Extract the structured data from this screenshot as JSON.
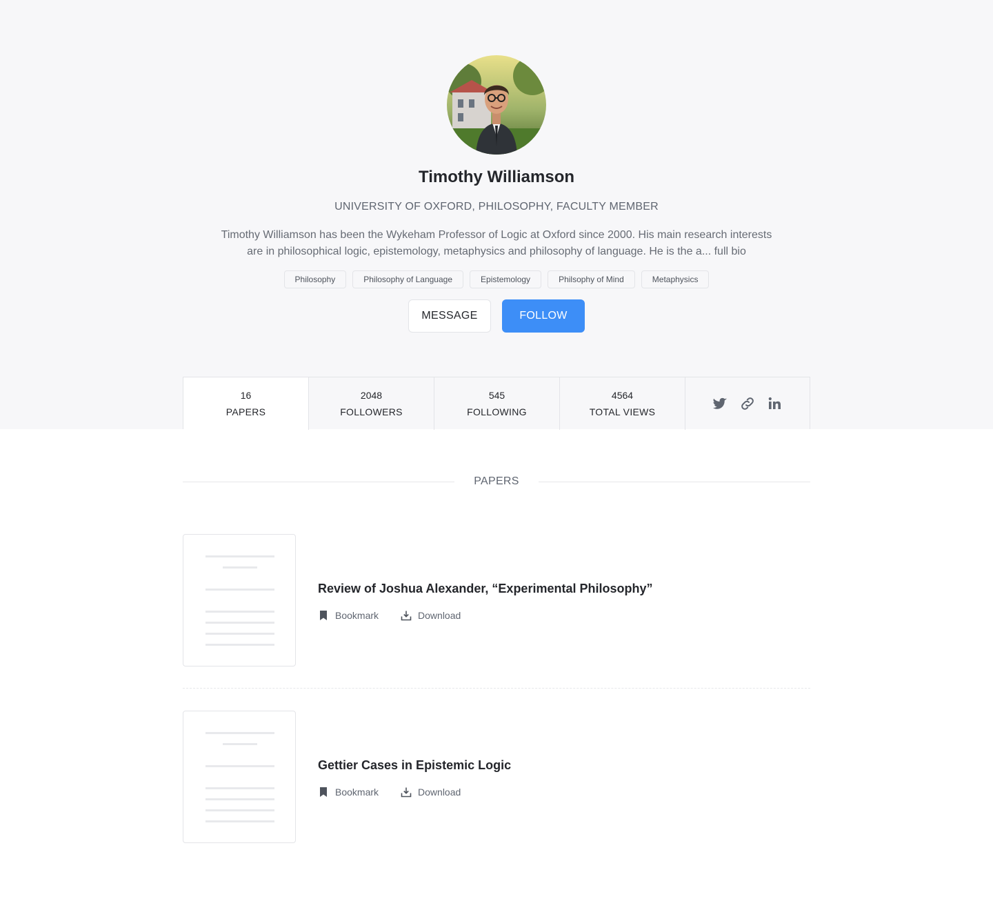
{
  "profile": {
    "name": "Timothy Williamson",
    "affiliation": "UNIVERSITY OF OXFORD, PHILOSOPHY, FACULTY MEMBER",
    "bio_line1": "Timothy Williamson has been the Wykeham Professor of Logic at Oxford since 2000. His main research interests",
    "bio_line2": "are in philosophical logic, epistemology, metaphysics and philosophy of language. He is the a... full bio",
    "tags": [
      "Philosophy",
      "Philosophy of Language",
      "Epistemology",
      "Philsophy of Mind",
      "Metaphysics"
    ]
  },
  "actions": {
    "message_label": "MESSAGE",
    "follow_label": "FOLLOW"
  },
  "stats": [
    {
      "value": "16",
      "label": "PAPERS"
    },
    {
      "value": "2048",
      "label": "FOLLOWERS"
    },
    {
      "value": "545",
      "label": "FOLLOWING"
    },
    {
      "value": "4564",
      "label": "TOTAL VIEWS"
    }
  ],
  "social_icons": [
    "twitter-icon",
    "link-icon",
    "linkedin-icon"
  ],
  "papers_section": {
    "title": "PAPERS",
    "items": [
      {
        "title": "Review of Joshua Alexander, “Experimental Philosophy”",
        "bookmark_label": "Bookmark",
        "download_label": "Download"
      },
      {
        "title": "Gettier Cases in Epistemic Logic",
        "bookmark_label": "Bookmark",
        "download_label": "Download"
      }
    ]
  },
  "colors": {
    "accent": "#3d8ef7",
    "hero_bg": "#f7f7f9",
    "text": "#24262b",
    "muted": "#5f6570"
  }
}
